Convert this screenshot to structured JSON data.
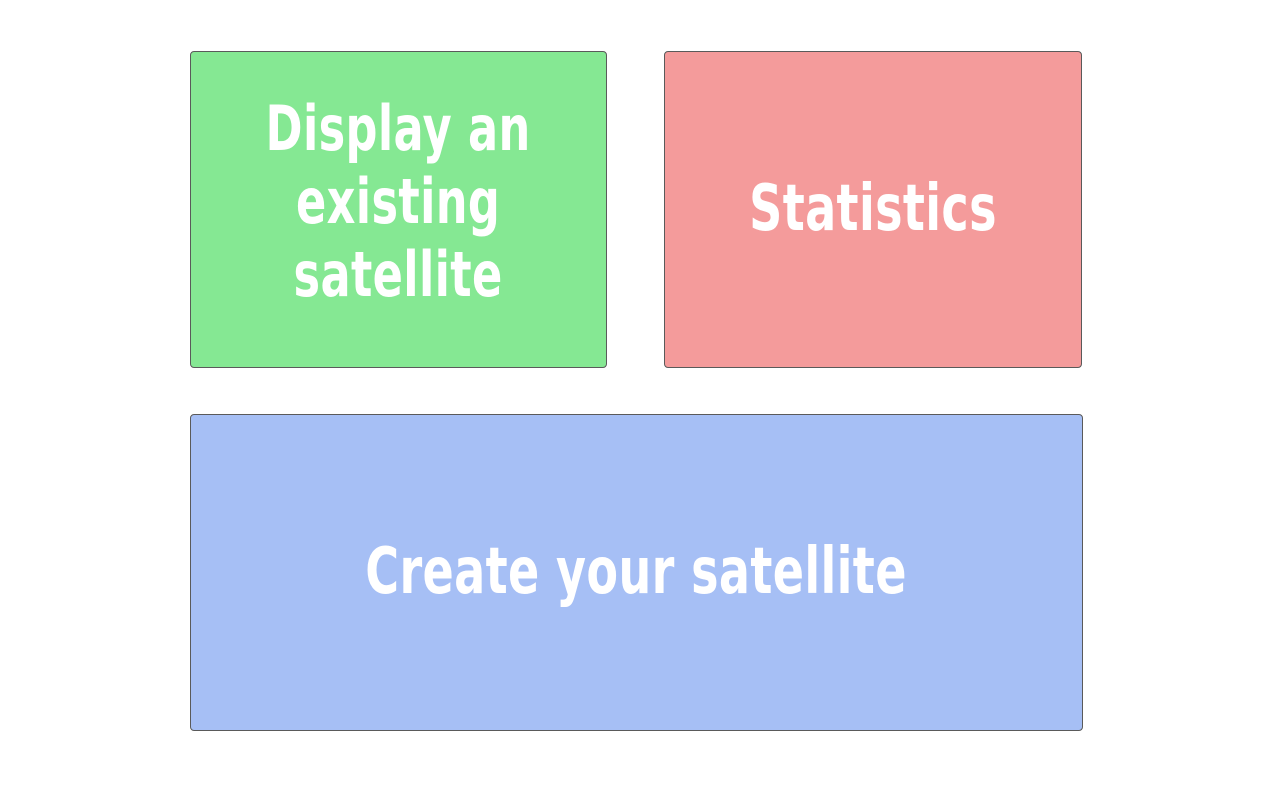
{
  "tiles": {
    "display_existing": {
      "label_lines": [
        "Display an",
        "existing",
        "satellite"
      ],
      "color": "#85e893"
    },
    "statistics": {
      "label": "Statistics",
      "color": "#f49b9b"
    },
    "create": {
      "label": "Create your satellite",
      "color": "#a6bff5"
    }
  }
}
